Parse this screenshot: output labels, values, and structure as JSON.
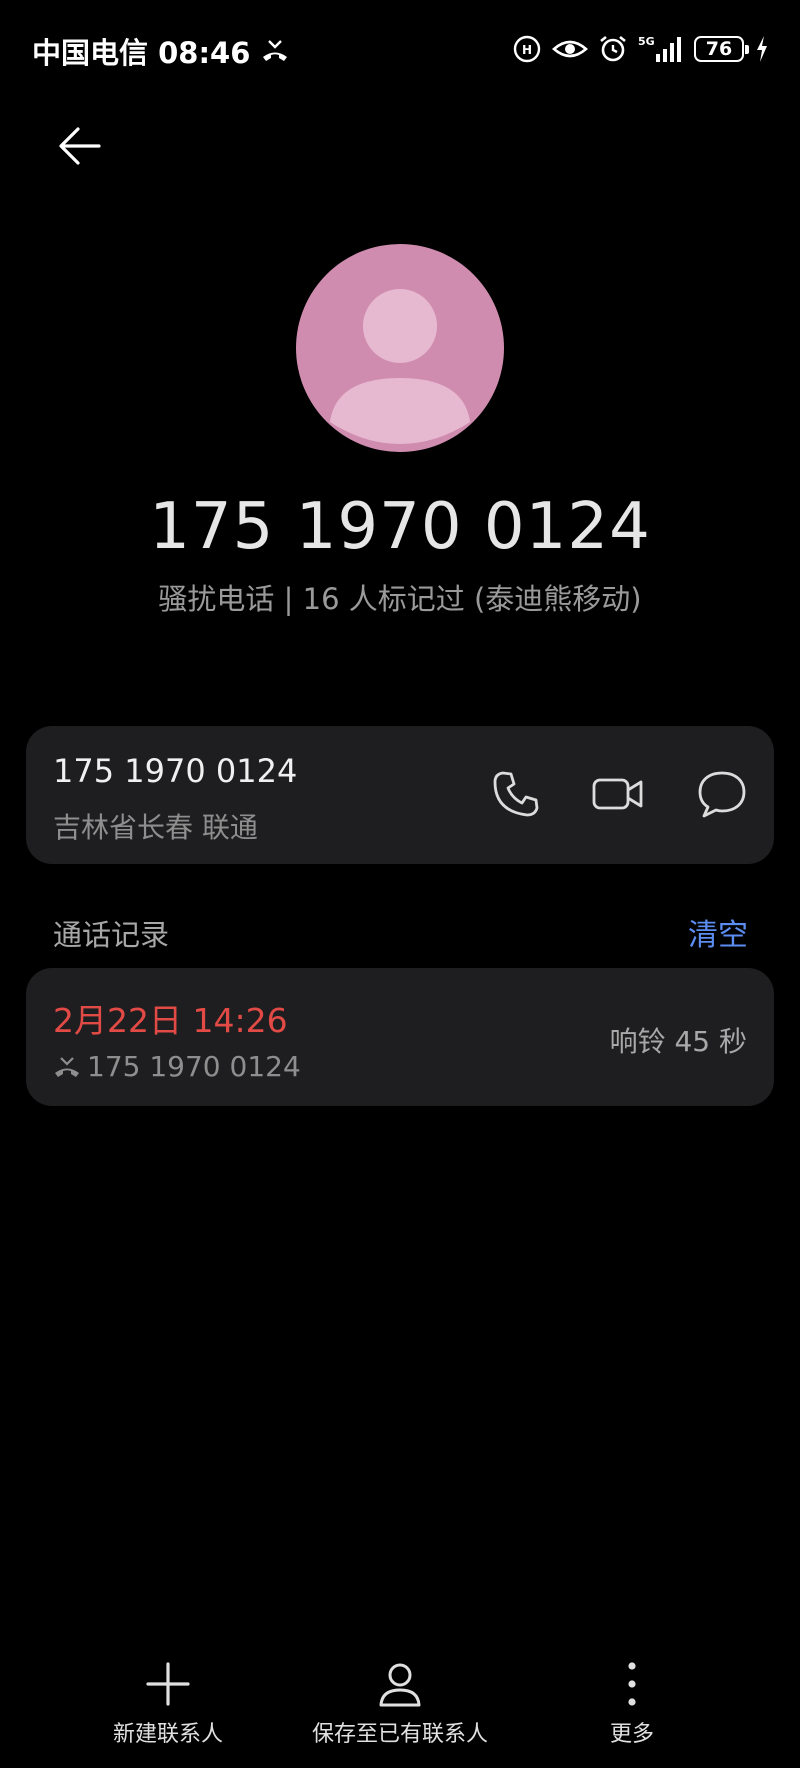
{
  "status_bar": {
    "carrier_time": "中国电信 08:46",
    "battery_level": "76",
    "network": "5G",
    "icons": [
      "missed-call-icon",
      "hd-icon",
      "eye-icon",
      "alarm-icon",
      "signal-icon",
      "battery-icon",
      "charging-icon"
    ]
  },
  "header": {
    "back_icon": "arrow-left-icon"
  },
  "contact": {
    "avatar_icon": "person-icon",
    "avatar_color": "#cf8caf",
    "number": "175 1970 0124",
    "tag": "骚扰电话 | 16 人标记过 (泰迪熊移动)"
  },
  "number_card": {
    "number": "175 1970 0124",
    "location": "吉林省长春 联通",
    "actions": [
      {
        "icon": "phone-icon"
      },
      {
        "icon": "video-call-icon"
      },
      {
        "icon": "message-icon"
      }
    ]
  },
  "call_log": {
    "title": "通话记录",
    "clear_label": "清空",
    "clear_color": "#5c8df2",
    "entries": [
      {
        "time": "2月22日 14:26",
        "time_color": "#e14a45",
        "number": "175 1970 0124",
        "icon": "missed-call-icon",
        "duration": "响铃 45 秒"
      }
    ]
  },
  "toolbar": {
    "new_contact_label": "新建联系人",
    "save_existing_label": "保存至已有联系人",
    "more_label": "更多"
  }
}
